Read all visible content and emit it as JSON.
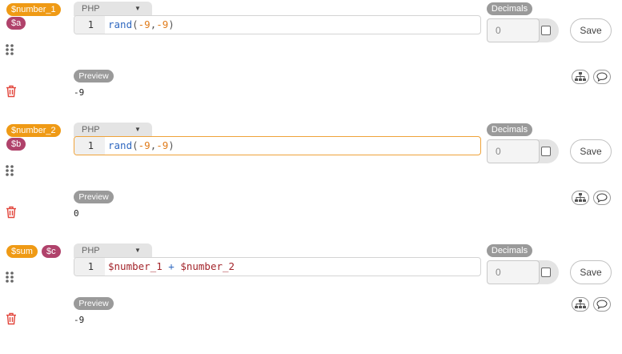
{
  "blocks": [
    {
      "var_name": "$number_1",
      "var_short": "$a",
      "language": "PHP",
      "line_number": "1",
      "code_tokens": [
        {
          "t": "rand",
          "c": "fn"
        },
        {
          "t": "(",
          "c": "punc"
        },
        {
          "t": "-9",
          "c": "num"
        },
        {
          "t": ",",
          "c": "punc"
        },
        {
          "t": "-9",
          "c": "num"
        },
        {
          "t": ")",
          "c": "punc"
        }
      ],
      "decimals_label": "Decimals",
      "decimals_value": "0",
      "save_label": "Save",
      "preview_label": "Preview",
      "preview_value": "-9"
    },
    {
      "var_name": "$number_2",
      "var_short": "$b",
      "language": "PHP",
      "line_number": "1",
      "code_tokens": [
        {
          "t": "rand",
          "c": "fn"
        },
        {
          "t": "(",
          "c": "punc"
        },
        {
          "t": "-9",
          "c": "num"
        },
        {
          "t": ",",
          "c": "punc"
        },
        {
          "t": "-9",
          "c": "num"
        },
        {
          "t": ")",
          "c": "punc"
        }
      ],
      "decimals_label": "Decimals",
      "decimals_value": "0",
      "save_label": "Save",
      "preview_label": "Preview",
      "preview_value": "0"
    },
    {
      "var_name": "$sum",
      "var_short": "$c",
      "language": "PHP",
      "line_number": "1",
      "code_tokens": [
        {
          "t": "$number_1",
          "c": "varc"
        },
        {
          "t": " + ",
          "c": "op"
        },
        {
          "t": "$number_2",
          "c": "varc"
        }
      ],
      "decimals_label": "Decimals",
      "decimals_value": "0",
      "save_label": "Save",
      "preview_label": "Preview",
      "preview_value": "-9"
    }
  ],
  "colors": {
    "var_name_badge": "#ef9a15",
    "var_short_badge": "#b0426b",
    "delete_icon": "#e2463c",
    "focus_border": "#efa33a"
  },
  "icons": {
    "drag": "grip-dots-icon",
    "delete": "trash-icon",
    "tree": "hierarchy-icon",
    "comment": "speech-bubble-icon",
    "dropdown": "caret-down-icon"
  }
}
